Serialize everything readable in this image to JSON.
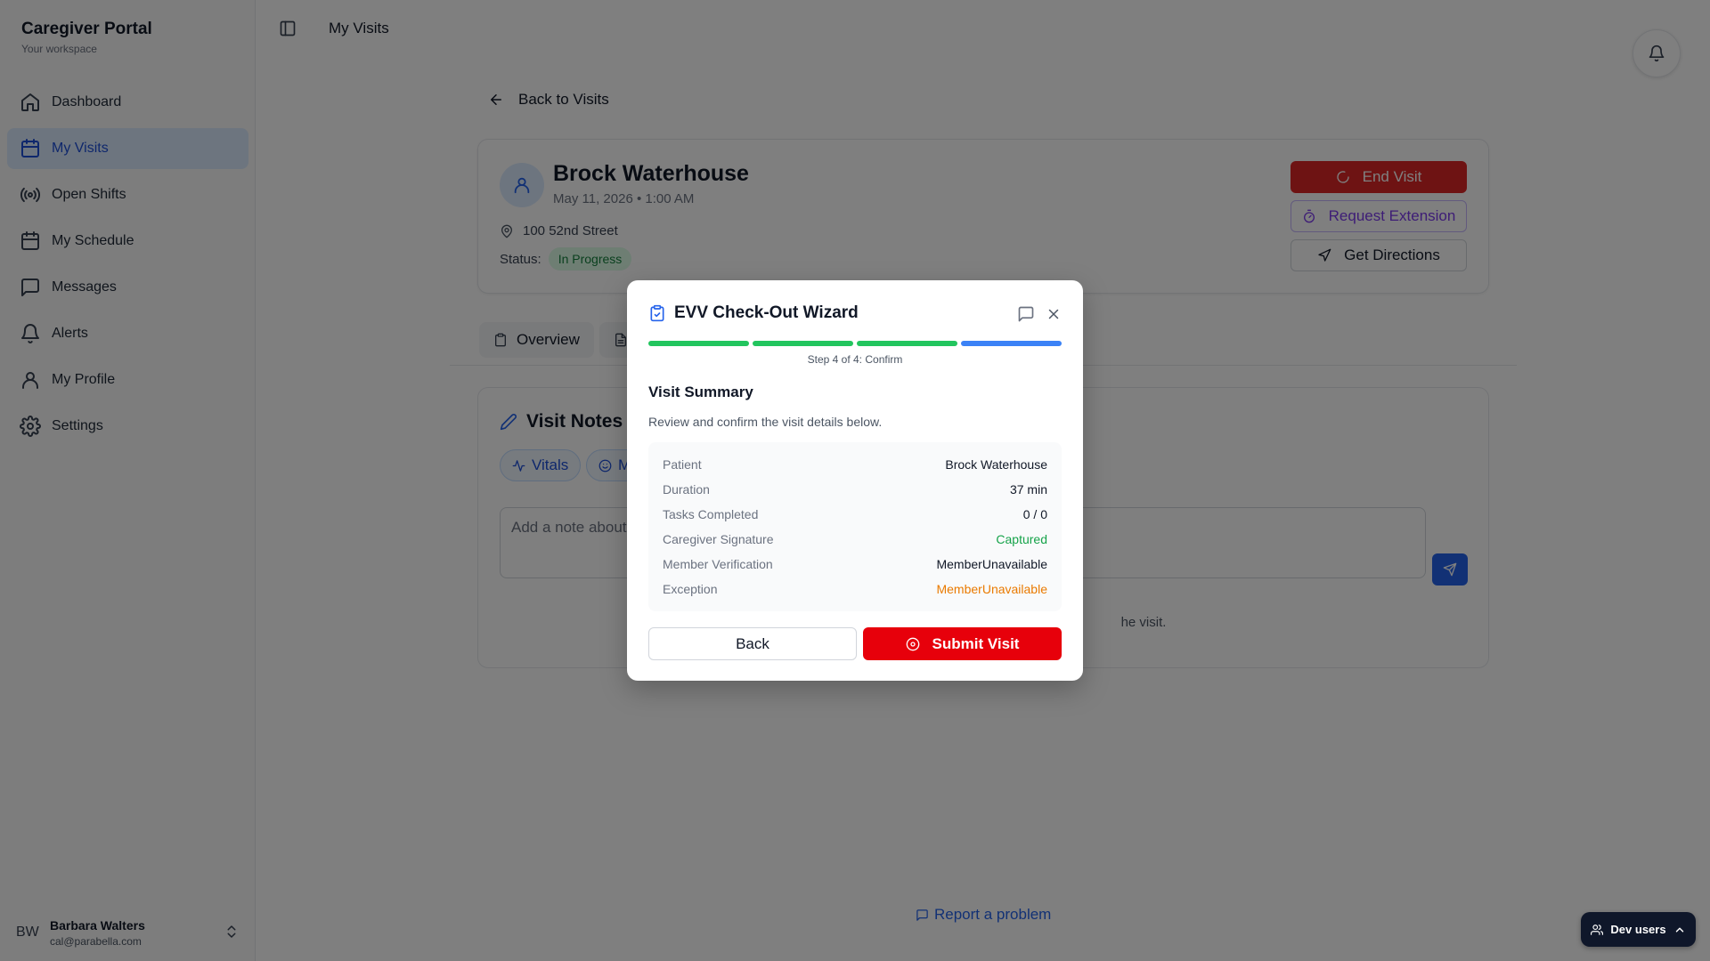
{
  "app": {
    "title": "Caregiver Portal",
    "subtitle": "Your workspace"
  },
  "sidebar": {
    "items": [
      {
        "label": "Dashboard",
        "icon": "home-icon",
        "active": false
      },
      {
        "label": "My Visits",
        "icon": "calendar-icon",
        "active": true
      },
      {
        "label": "Open Shifts",
        "icon": "radio-icon",
        "active": false
      },
      {
        "label": "My Schedule",
        "icon": "calendar-icon",
        "active": false
      },
      {
        "label": "Messages",
        "icon": "message-icon",
        "active": false
      },
      {
        "label": "Alerts",
        "icon": "bell-icon",
        "active": false
      },
      {
        "label": "My Profile",
        "icon": "user-icon",
        "active": false
      },
      {
        "label": "Settings",
        "icon": "gear-icon",
        "active": false
      }
    ],
    "user": {
      "initials": "BW",
      "name": "Barbara Walters",
      "email": "cal@parabella.com"
    }
  },
  "header": {
    "title": "My Visits"
  },
  "main": {
    "back_label": "Back to Visits",
    "visit": {
      "patient_name": "Brock Waterhouse",
      "datetime": "May 11, 2026 • 1:00 AM",
      "address": "100 52nd Street",
      "status_label": "Status:",
      "status": "In Progress",
      "actions": {
        "end": "End Visit",
        "extension": "Request Extension",
        "directions": "Get Directions"
      }
    },
    "tabs": [
      {
        "label": "Overview"
      }
    ],
    "notes": {
      "title": "Visit Notes",
      "chips": [
        {
          "label": "Vitals"
        },
        {
          "label": "M"
        }
      ],
      "placeholder": "Add a note about",
      "hint": "he visit."
    },
    "report_problem": "Report a problem"
  },
  "dev_users": "Dev users",
  "modal": {
    "title": "EVV Check-Out Wizard",
    "step_label": "Step 4 of 4: Confirm",
    "steps": [
      {
        "state": "done"
      },
      {
        "state": "done"
      },
      {
        "state": "done"
      },
      {
        "state": "current"
      }
    ],
    "summary_title": "Visit Summary",
    "summary_sub": "Review and confirm the visit details below.",
    "rows": [
      {
        "label": "Patient",
        "value": "Brock Waterhouse",
        "tone": "default"
      },
      {
        "label": "Duration",
        "value": "37 min",
        "tone": "default"
      },
      {
        "label": "Tasks Completed",
        "value": "0 / 0",
        "tone": "default"
      },
      {
        "label": "Caregiver Signature",
        "value": "Captured",
        "tone": "success"
      },
      {
        "label": "Member Verification",
        "value": "MemberUnavailable",
        "tone": "default"
      },
      {
        "label": "Exception",
        "value": "MemberUnavailable",
        "tone": "warning"
      }
    ],
    "back_label": "Back",
    "submit_label": "Submit Visit"
  },
  "colors": {
    "primary": "#2563eb",
    "danger": "#e7000b",
    "success": "#16a34a",
    "warning": "#ea7a00",
    "step_done": "#22c55e",
    "step_current": "#3b82f6"
  }
}
